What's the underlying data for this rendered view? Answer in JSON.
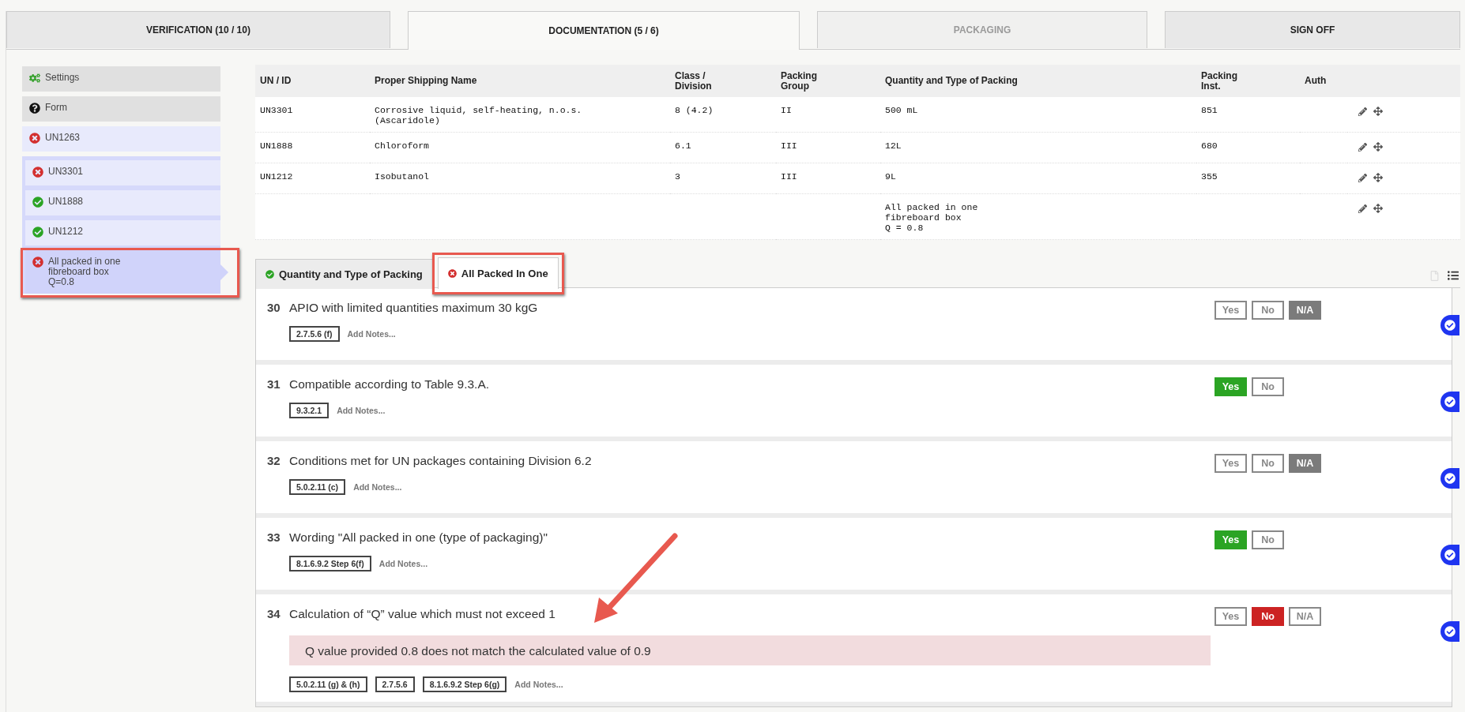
{
  "top_tabs": [
    {
      "label": "VERIFICATION (10 / 10)",
      "selected": false,
      "disabled": false
    },
    {
      "label": "DOCUMENTATION (5 / 6)",
      "selected": true,
      "disabled": false
    },
    {
      "label": "PACKAGING",
      "selected": false,
      "disabled": true
    },
    {
      "label": "SIGN OFF",
      "selected": false,
      "disabled": false
    }
  ],
  "sidebar": {
    "items": [
      {
        "label": "Settings",
        "kind": "settings",
        "selected": false
      },
      {
        "label": "Form",
        "kind": "help",
        "selected": false
      },
      {
        "label": "UN1263",
        "kind": "error",
        "selected": false
      }
    ],
    "group": [
      {
        "label": "UN3301",
        "kind": "error",
        "selected": false,
        "annotated": false
      },
      {
        "label": "UN1888",
        "kind": "ok",
        "selected": false,
        "annotated": false
      },
      {
        "label": "UN1212",
        "kind": "ok",
        "selected": false,
        "annotated": false
      },
      {
        "label": "All packed in one\nfibreboard box\nQ=0.8",
        "kind": "error",
        "selected": true,
        "annotated": true
      }
    ]
  },
  "table": {
    "columns": [
      "UN / ID",
      "Proper Shipping Name",
      "Class /\nDivision",
      "Packing\nGroup",
      "Quantity and Type of Packing",
      "Packing\nInst.",
      "Auth"
    ],
    "rows": [
      [
        "UN3301",
        "Corrosive liquid, self-heating, n.o.s.\n(Ascaridole)",
        "8 (4.2)",
        "II",
        "500 mL",
        "851",
        ""
      ],
      [
        "UN1888",
        "Chloroform",
        "6.1",
        "III",
        "12L",
        "680",
        ""
      ],
      [
        "UN1212",
        "Isobutanol",
        "3",
        "III",
        "9L",
        "355",
        ""
      ],
      [
        "",
        "",
        "",
        "",
        "All packed in one\nfibreboard box\nQ = 0.8",
        "",
        ""
      ]
    ]
  },
  "section_tabs": [
    {
      "label": "Quantity and Type of Packing",
      "kind": "ok",
      "selected": false,
      "annotated": false
    },
    {
      "label": "All Packed In One",
      "kind": "error",
      "selected": true,
      "annotated": true
    }
  ],
  "questions": [
    {
      "number": "30",
      "text": "APIO with limited quantities maximum 30 kgG",
      "refs": [
        "2.7.5.6 (f)"
      ],
      "notes": "Add Notes...",
      "options": [
        {
          "label": "Yes",
          "kind": "yes",
          "selected": false
        },
        {
          "label": "No",
          "kind": "no",
          "selected": false
        },
        {
          "label": "N/A",
          "kind": "na",
          "selected": true
        }
      ]
    },
    {
      "number": "31",
      "text": "Compatible according to Table 9.3.A.",
      "refs": [
        "9.3.2.1"
      ],
      "notes": "Add Notes...",
      "options": [
        {
          "label": "Yes",
          "kind": "yes",
          "selected": true
        },
        {
          "label": "No",
          "kind": "no",
          "selected": false
        }
      ]
    },
    {
      "number": "32",
      "text": "Conditions met for UN packages containing Division 6.2",
      "refs": [
        "5.0.2.11 (c)"
      ],
      "notes": "Add Notes...",
      "options": [
        {
          "label": "Yes",
          "kind": "yes",
          "selected": false
        },
        {
          "label": "No",
          "kind": "no",
          "selected": false
        },
        {
          "label": "N/A",
          "kind": "na",
          "selected": true
        }
      ]
    },
    {
      "number": "33",
      "text": "Wording \"All packed in one (type of packaging)\"",
      "refs": [
        "8.1.6.9.2 Step 6(f)"
      ],
      "notes": "Add Notes...",
      "options": [
        {
          "label": "Yes",
          "kind": "yes",
          "selected": true
        },
        {
          "label": "No",
          "kind": "no",
          "selected": false
        }
      ]
    },
    {
      "number": "34",
      "text": "Calculation of “Q” value which must not exceed 1",
      "error": "Q value provided 0.8 does not match the calculated value of 0.9",
      "refs": [
        "5.0.2.11 (g) & (h)",
        "2.7.5.6",
        "8.1.6.9.2 Step 6(g)"
      ],
      "notes": "Add Notes...",
      "options": [
        {
          "label": "Yes",
          "kind": "yes",
          "selected": false
        },
        {
          "label": "No",
          "kind": "no",
          "selected": true
        },
        {
          "label": "N/A",
          "kind": "na",
          "selected": false
        }
      ]
    }
  ]
}
